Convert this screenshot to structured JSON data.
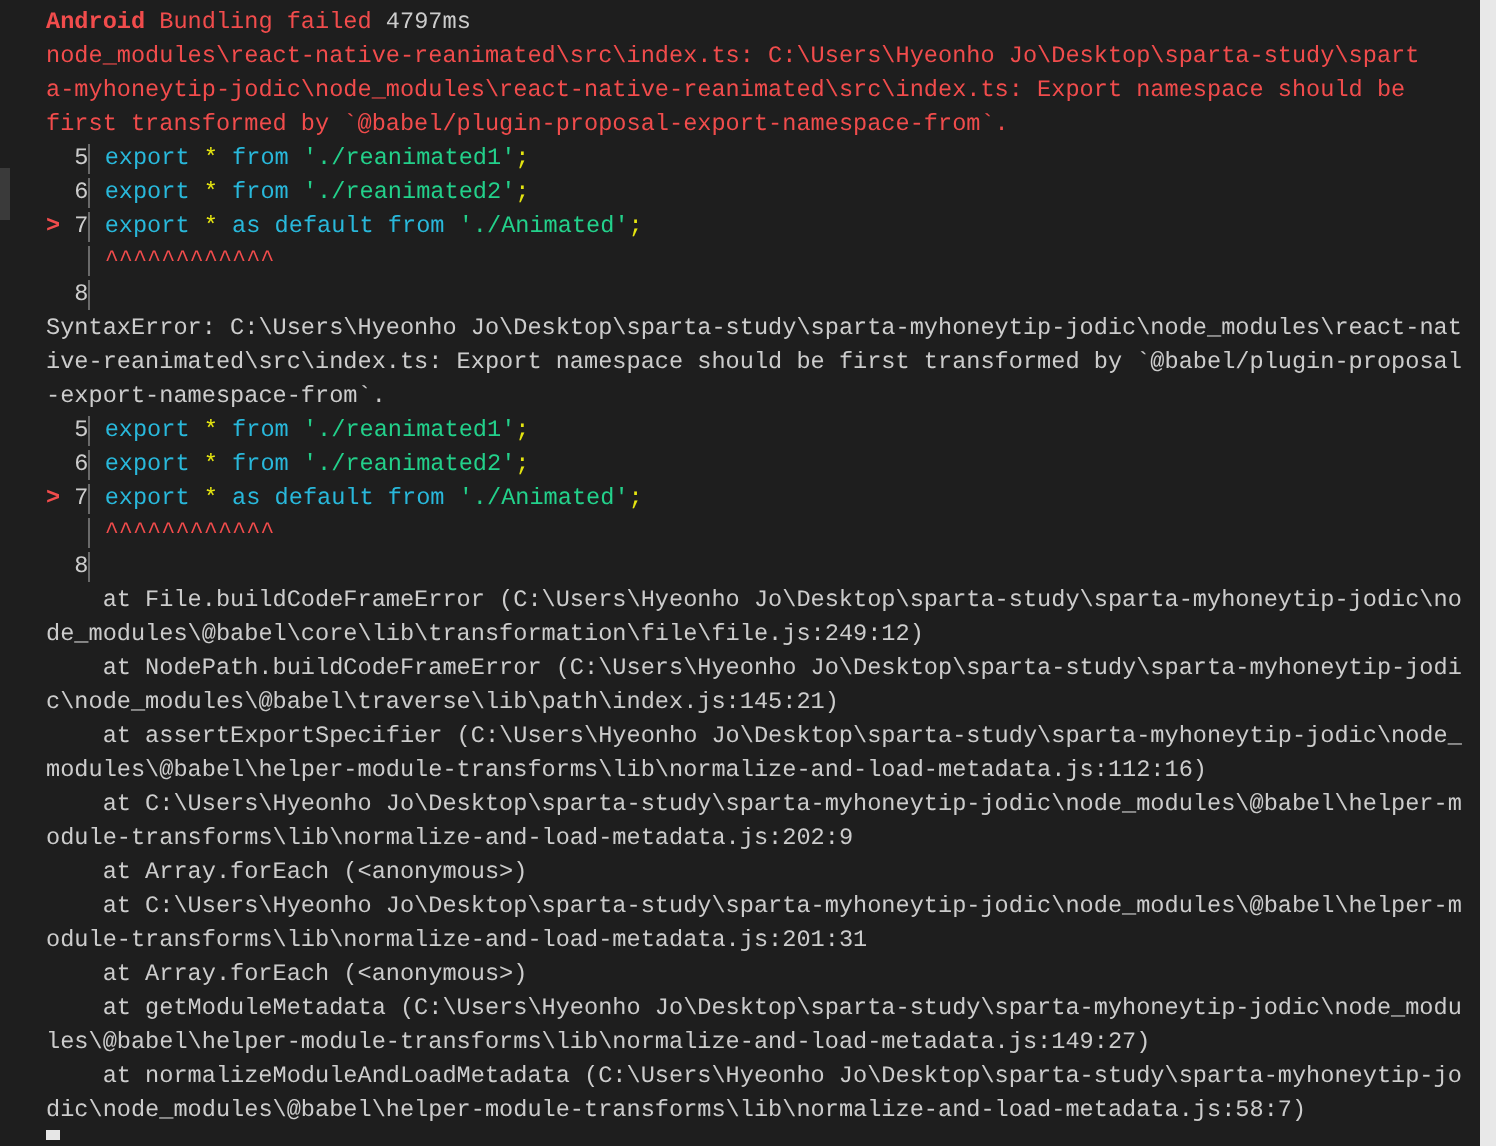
{
  "header": {
    "platform": "Android",
    "message": "Bundling failed",
    "duration": "4797ms"
  },
  "error_lines": [
    "node_modules\\react-native-reanimated\\src\\index.ts: C:\\Users\\Hyeonho Jo\\Desktop\\sparta-study\\spart",
    "a-myhoneytip-jodic\\node_modules\\react-native-reanimated\\src\\index.ts: Export namespace should be",
    "first transformed by `@babel/plugin-proposal-export-namespace-from`."
  ],
  "code_frames": [
    {
      "rows": [
        {
          "kind": "code",
          "number": "5",
          "tokens": [
            {
              "kind": "kw",
              "s": "export"
            },
            {
              "kind": "op",
              "s": "*"
            },
            {
              "kind": "kw",
              "s": "from"
            },
            {
              "kind": "str",
              "s": "'./reanimated1'"
            },
            {
              "kind": "punct",
              "s": ";"
            }
          ]
        },
        {
          "kind": "code",
          "number": "6",
          "tokens": [
            {
              "kind": "kw",
              "s": "export"
            },
            {
              "kind": "op",
              "s": "*"
            },
            {
              "kind": "kw",
              "s": "from"
            },
            {
              "kind": "str",
              "s": "'./reanimated2'"
            },
            {
              "kind": "punct",
              "s": ";"
            }
          ]
        },
        {
          "kind": "code",
          "number": "7",
          "marker": ">",
          "tokens": [
            {
              "kind": "kw",
              "s": "export"
            },
            {
              "kind": "op",
              "s": "*"
            },
            {
              "kind": "kw",
              "s": "as default"
            },
            {
              "kind": "kw",
              "s": "from"
            },
            {
              "kind": "str",
              "s": "'./Animated'"
            },
            {
              "kind": "punct",
              "s": ";"
            }
          ]
        },
        {
          "kind": "caret",
          "text": "^^^^^^^^^^^^"
        },
        {
          "kind": "code",
          "number": "8",
          "tokens": []
        }
      ]
    },
    {
      "rows": [
        {
          "kind": "code",
          "number": "5",
          "tokens": [
            {
              "kind": "kw",
              "s": "export"
            },
            {
              "kind": "op",
              "s": "*"
            },
            {
              "kind": "kw",
              "s": "from"
            },
            {
              "kind": "str",
              "s": "'./reanimated1'"
            },
            {
              "kind": "punct",
              "s": ";"
            }
          ]
        },
        {
          "kind": "code",
          "number": "6",
          "tokens": [
            {
              "kind": "kw",
              "s": "export"
            },
            {
              "kind": "op",
              "s": "*"
            },
            {
              "kind": "kw",
              "s": "from"
            },
            {
              "kind": "str",
              "s": "'./reanimated2'"
            },
            {
              "kind": "punct",
              "s": ";"
            }
          ]
        },
        {
          "kind": "code",
          "number": "7",
          "marker": ">",
          "tokens": [
            {
              "kind": "kw",
              "s": "export"
            },
            {
              "kind": "op",
              "s": "*"
            },
            {
              "kind": "kw",
              "s": "as default"
            },
            {
              "kind": "kw",
              "s": "from"
            },
            {
              "kind": "str",
              "s": "'./Animated'"
            },
            {
              "kind": "punct",
              "s": ";"
            }
          ]
        },
        {
          "kind": "caret",
          "text": "^^^^^^^^^^^^"
        },
        {
          "kind": "code",
          "number": "8",
          "tokens": []
        }
      ]
    }
  ],
  "syntax_error_lines": [
    "SyntaxError: C:\\Users\\Hyeonho Jo\\Desktop\\sparta-study\\sparta-myhoneytip-jodic\\node_modules\\react-nat",
    "ive-reanimated\\src\\index.ts: Export namespace should be first transformed by `@babel/plugin-proposal",
    "-export-namespace-from`."
  ],
  "stack_lines": [
    {
      "kind": "frame",
      "text": "at File.buildCodeFrameError (C:\\Users\\Hyeonho Jo\\Desktop\\sparta-study\\sparta-myhoneytip-jodic\\no"
    },
    {
      "kind": "continuation",
      "text": "de_modules\\@babel\\core\\lib\\transformation\\file\\file.js:249:12)"
    },
    {
      "kind": "frame",
      "text": "at NodePath.buildCodeFrameError (C:\\Users\\Hyeonho Jo\\Desktop\\sparta-study\\sparta-myhoneytip-jodi"
    },
    {
      "kind": "continuation",
      "text": "c\\node_modules\\@babel\\traverse\\lib\\path\\index.js:145:21)"
    },
    {
      "kind": "frame",
      "text": "at assertExportSpecifier (C:\\Users\\Hyeonho Jo\\Desktop\\sparta-study\\sparta-myhoneytip-jodic\\node_"
    },
    {
      "kind": "continuation",
      "text": "modules\\@babel\\helper-module-transforms\\lib\\normalize-and-load-metadata.js:112:16)"
    },
    {
      "kind": "frame",
      "text": "at C:\\Users\\Hyeonho Jo\\Desktop\\sparta-study\\sparta-myhoneytip-jodic\\node_modules\\@babel\\helper-m"
    },
    {
      "kind": "continuation",
      "text": "odule-transforms\\lib\\normalize-and-load-metadata.js:202:9"
    },
    {
      "kind": "frame",
      "text": "at Array.forEach (<anonymous>)"
    },
    {
      "kind": "frame",
      "text": "at C:\\Users\\Hyeonho Jo\\Desktop\\sparta-study\\sparta-myhoneytip-jodic\\node_modules\\@babel\\helper-m"
    },
    {
      "kind": "continuation",
      "text": "odule-transforms\\lib\\normalize-and-load-metadata.js:201:31"
    },
    {
      "kind": "frame",
      "text": "at Array.forEach (<anonymous>)"
    },
    {
      "kind": "frame",
      "text": "at getModuleMetadata (C:\\Users\\Hyeonho Jo\\Desktop\\sparta-study\\sparta-myhoneytip-jodic\\node_modu"
    },
    {
      "kind": "continuation",
      "text": "les\\@babel\\helper-module-transforms\\lib\\normalize-and-load-metadata.js:149:27)"
    },
    {
      "kind": "frame",
      "text": "at normalizeModuleAndLoadMetadata (C:\\Users\\Hyeonho Jo\\Desktop\\sparta-study\\sparta-myhoneytip-jo"
    },
    {
      "kind": "continuation",
      "text": "dic\\node_modules\\@babel\\helper-module-transforms\\lib\\normalize-and-load-metadata.js:58:7)"
    }
  ]
}
